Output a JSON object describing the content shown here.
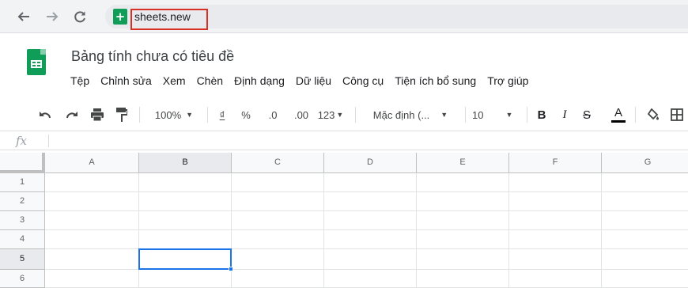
{
  "browser": {
    "url": "sheets.new"
  },
  "sheet": {
    "title": "Bảng tính chưa có tiêu đề"
  },
  "menu": [
    "Tệp",
    "Chỉnh sửa",
    "Xem",
    "Chèn",
    "Định dạng",
    "Dữ liệu",
    "Công cụ",
    "Tiện ích bổ sung",
    "Trợ giúp"
  ],
  "toolbar": {
    "zoom": "100%",
    "currency": "₫",
    "percent": "%",
    "decimal_decrease": ".0",
    "decimal_increase": ".00",
    "more_formats": "123",
    "font": "Mặc định (...",
    "font_size": "10",
    "bold": "B",
    "italic": "I",
    "strikethrough": "S",
    "text_color": "A",
    "text_color_value": "#000000"
  },
  "formula_bar": {
    "label": "fx",
    "value": ""
  },
  "grid": {
    "columns": [
      "A",
      "B",
      "C",
      "D",
      "E",
      "F",
      "G"
    ],
    "rows": [
      "1",
      "2",
      "3",
      "4",
      "5",
      "6"
    ],
    "selected_cell": "B5"
  },
  "colors": {
    "brand": "#0f9d58",
    "selection": "#1a73e8",
    "url_highlight": "#d93025"
  }
}
